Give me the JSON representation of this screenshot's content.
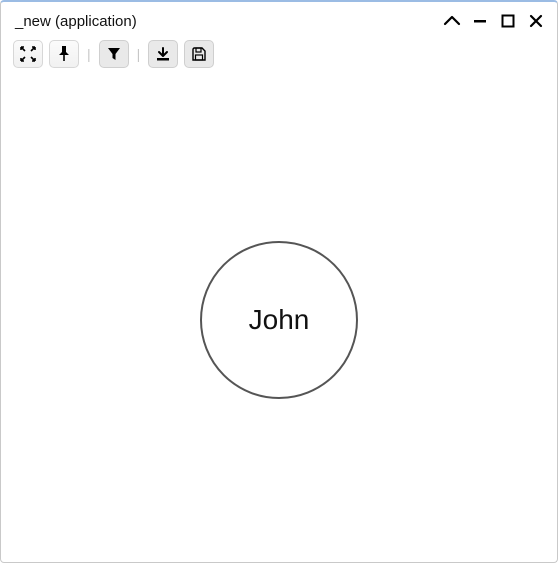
{
  "window": {
    "title": "_new (application)"
  },
  "node": {
    "label": "John"
  }
}
